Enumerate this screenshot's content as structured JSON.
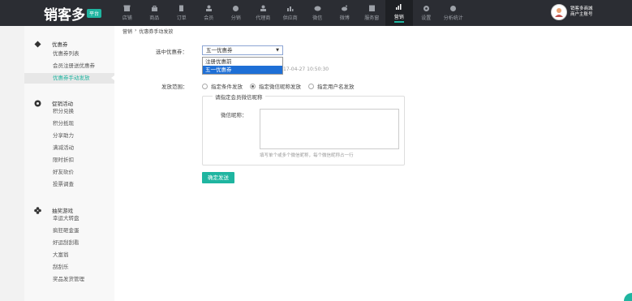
{
  "logo": {
    "text": "销客多",
    "badge": "平台"
  },
  "nav": [
    {
      "label": "店铺",
      "icon": "store-icon"
    },
    {
      "label": "商品",
      "icon": "goods-icon"
    },
    {
      "label": "订单",
      "icon": "order-icon"
    },
    {
      "label": "会员",
      "icon": "member-icon"
    },
    {
      "label": "分销",
      "icon": "distribution-icon"
    },
    {
      "label": "代理商",
      "icon": "agent-icon"
    },
    {
      "label": "供应商",
      "icon": "supplier-icon"
    },
    {
      "label": "微信",
      "icon": "wechat-icon"
    },
    {
      "label": "微博",
      "icon": "weibo-icon"
    },
    {
      "label": "服务窗",
      "icon": "service-window-icon"
    },
    {
      "label": "营销",
      "icon": "marketing-icon"
    },
    {
      "label": "设置",
      "icon": "settings-icon"
    },
    {
      "label": "分析统计",
      "icon": "analytics-icon"
    }
  ],
  "user": {
    "line1": "销客多商城",
    "line2": "商户主账号"
  },
  "sidebar": {
    "sections": [
      {
        "title": "优惠券",
        "icon": "diamond-icon",
        "items": [
          "优惠券列表",
          "会员注册送优惠券",
          "优惠券手动发放"
        ]
      },
      {
        "title": "促销活动",
        "icon": "circle-icon",
        "items": [
          "积分兑换",
          "积分抵现",
          "分享助力",
          "满减活动",
          "限时折扣",
          "好友砍价",
          "投票调查"
        ]
      },
      {
        "title": "抽奖游戏",
        "icon": "flower-icon",
        "items": [
          "幸运大转盘",
          "疯狂砸金蛋",
          "好运刮刮看",
          "大富翁",
          "刮刮乐",
          "奖品发货管理"
        ]
      }
    ],
    "active_item": "优惠券手动发放"
  },
  "breadcrumb": {
    "root": "营销",
    "sep": "›",
    "current": "优惠券手动发放"
  },
  "form": {
    "coupon_label": "选中优惠券：",
    "coupon_selected": "五一优惠券",
    "coupon_options": [
      "注册优惠前",
      "五一优惠券"
    ],
    "time_text": "17-04-27 10:50:30",
    "range_label": "发放范围：",
    "range_options": [
      "指定条件发放",
      "指定微信昵称发放",
      "指定用户名发放"
    ],
    "range_selected_index": 1,
    "nick_group_title": "请指定会员微信昵称",
    "nick_label": "微信昵称：",
    "nick_value": "",
    "nick_hint": "填写单个或多个微信昵称，每个微信昵称占一行",
    "submit": "确定发送"
  },
  "colors": {
    "accent": "#1fb5a0",
    "topbar": "#2b2d33",
    "highlight": "#1e6fd6"
  }
}
